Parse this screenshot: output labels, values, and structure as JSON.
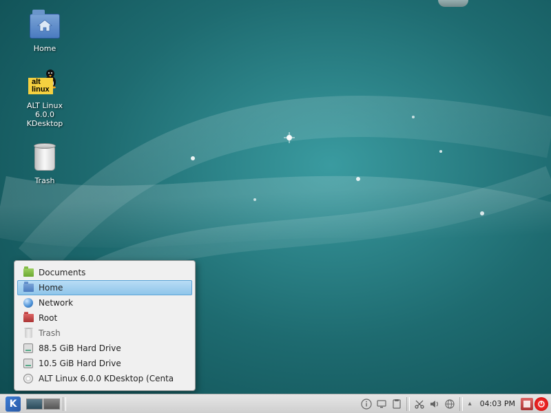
{
  "desktop": {
    "icons": [
      {
        "name": "home",
        "label": "Home"
      },
      {
        "name": "altlinux",
        "label": "ALT Linux 6.0.0 KDesktop",
        "badge_top": "alt",
        "badge_bottom": "linux"
      },
      {
        "name": "trash",
        "label": "Trash"
      }
    ]
  },
  "places_menu": {
    "items": [
      {
        "icon": "folder-green",
        "label": "Documents",
        "highlight": false
      },
      {
        "icon": "folder-blue",
        "label": "Home",
        "highlight": true
      },
      {
        "icon": "globe",
        "label": "Network",
        "highlight": false
      },
      {
        "icon": "folder-red",
        "label": "Root",
        "highlight": false
      },
      {
        "icon": "trash",
        "label": "Trash",
        "highlight": false,
        "muted": true
      },
      {
        "icon": "hdd",
        "label": "88.5 GiB Hard Drive",
        "highlight": false
      },
      {
        "icon": "hdd",
        "label": "10.5 GiB Hard Drive",
        "highlight": false
      },
      {
        "icon": "disc",
        "label": "ALT Linux 6.0.0 KDesktop  (Centa",
        "highlight": false
      }
    ]
  },
  "panel": {
    "klogo": "K",
    "clock": "04:03 PM",
    "power_glyph": "⏻"
  },
  "colors": {
    "wallpaper_base": "#1e6b70",
    "highlight": "#8fc5ea"
  }
}
